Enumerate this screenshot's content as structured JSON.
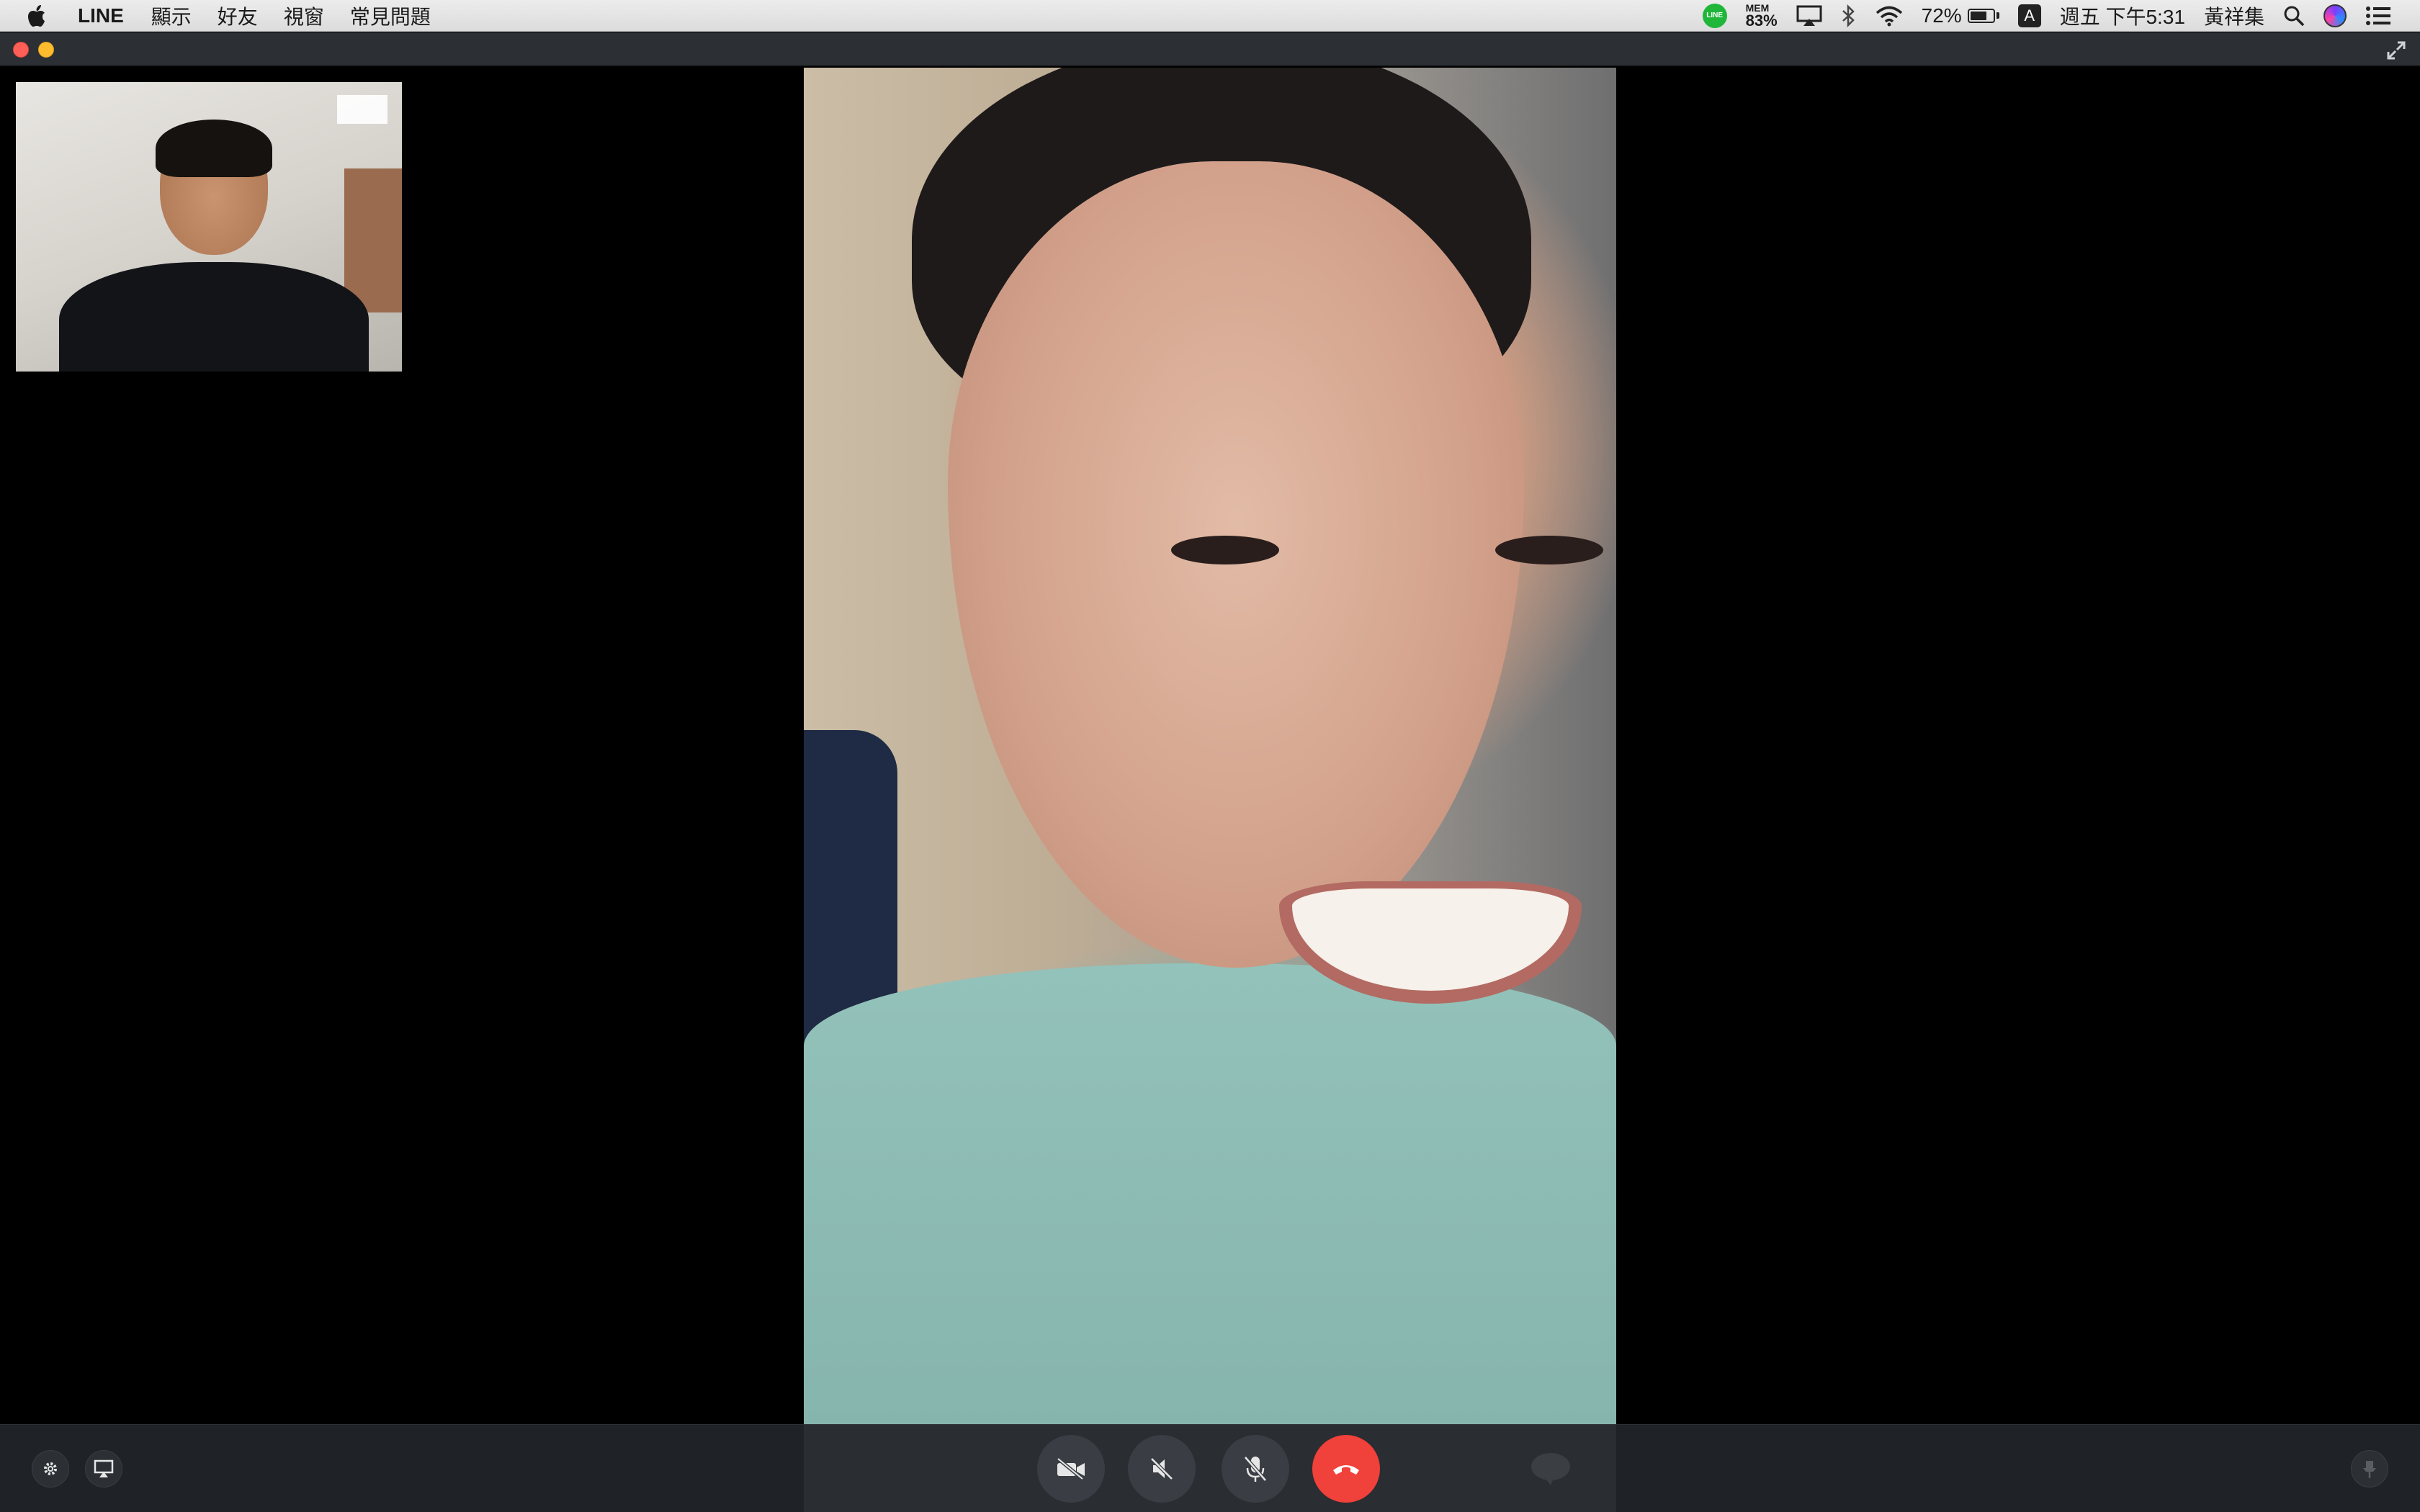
{
  "menubar": {
    "app_name": "LINE",
    "menus": [
      "顯示",
      "好友",
      "視窗",
      "常見問題"
    ],
    "status": {
      "mem_label": "MEM",
      "mem_value": "83%",
      "battery_percent_text": "72%",
      "battery_level": 0.72,
      "input_source": "A",
      "datetime": "週五 下午5:31",
      "user_name": "黃祥集"
    }
  },
  "icons": {
    "apple": "apple-icon",
    "line_status": "line-icon",
    "airplay": "airplay-icon",
    "bluetooth": "bluetooth-icon",
    "wifi": "wifi-icon",
    "search": "spotlight-search-icon",
    "siri": "siri-icon",
    "notifications": "notification-center-icon"
  },
  "controls": {
    "left": [
      "settings",
      "screen-share"
    ],
    "center": [
      "camera-off",
      "speaker-mute",
      "microphone-mute",
      "end-call",
      "chat"
    ],
    "right": [
      "pin"
    ]
  },
  "colors": {
    "end_call": "#f0413a",
    "line_green": "#1fb63a",
    "control_bar": "#1f2226",
    "close_light": "#fe5f57",
    "minimize_light": "#febc2e"
  }
}
